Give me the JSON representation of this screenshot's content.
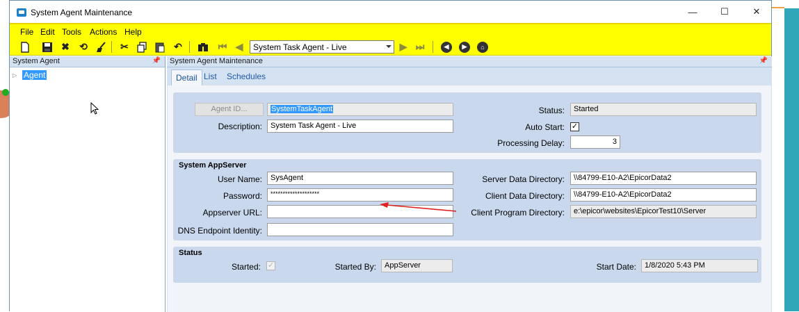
{
  "window": {
    "title": "System Agent Maintenance",
    "controls": {
      "minimize": "—",
      "maximize": "☐",
      "close": "✕"
    }
  },
  "menu": [
    "File",
    "Edit",
    "Tools",
    "Actions",
    "Help"
  ],
  "toolbar": {
    "icons": [
      "new-icon",
      "save-icon",
      "delete-icon",
      "refresh-icon",
      "clear-icon",
      "cut-icon",
      "copy-icon",
      "paste-icon",
      "undo-icon",
      "search-icon",
      "first-icon",
      "previous-icon",
      "next-icon",
      "last-icon",
      "back-icon",
      "forward-icon",
      "home-icon"
    ],
    "record_selector": "System Task Agent - Live"
  },
  "left_pane": {
    "header": "System Agent",
    "tree": [
      {
        "label": "Agent"
      }
    ]
  },
  "right_pane": {
    "header": "System Agent Maintenance",
    "tabs": [
      "Detail",
      "List",
      "Schedules"
    ]
  },
  "agent": {
    "agent_id_button": "Agent ID...",
    "agent_id_value": "SystemTaskAgent",
    "description_label": "Description:",
    "description_value": "System Task Agent - Live",
    "status_label": "Status:",
    "status_value": "Started",
    "auto_start_label": "Auto Start:",
    "auto_start_checked": true,
    "processing_delay_label": "Processing Delay:",
    "processing_delay_value": "3"
  },
  "appserver": {
    "title": "System AppServer",
    "user_name_label": "User Name:",
    "user_name_value": "SysAgent",
    "password_label": "Password:",
    "password_value": "********************",
    "appserver_url_label": "Appserver URL:",
    "appserver_url_value": "",
    "dns_label": "DNS Endpoint Identity:",
    "dns_value": "",
    "server_data_dir_label": "Server Data Directory:",
    "server_data_dir_value": "\\\\84799-E10-A2\\EpicorData2",
    "client_data_dir_label": "Client Data Directory:",
    "client_data_dir_value": "\\\\84799-E10-A2\\EpicorData2",
    "client_program_dir_label": "Client Program Directory:",
    "client_program_dir_value": "e:\\epicor\\websites\\EpicorTest10\\Server"
  },
  "status_group": {
    "title": "Status",
    "started_label": "Started:",
    "started_checked": true,
    "started_by_label": "Started By:",
    "started_by_value": "AppServer",
    "start_date_label": "Start Date:",
    "start_date_value": "1/8/2020 5:43 PM"
  },
  "colors": {
    "toolbar_bg": "#ffff00",
    "pane_bg": "#d4e2f2",
    "group_bg": "#c9d8ec",
    "selection": "#3399ff",
    "annotation_arrow": "#e02020"
  }
}
